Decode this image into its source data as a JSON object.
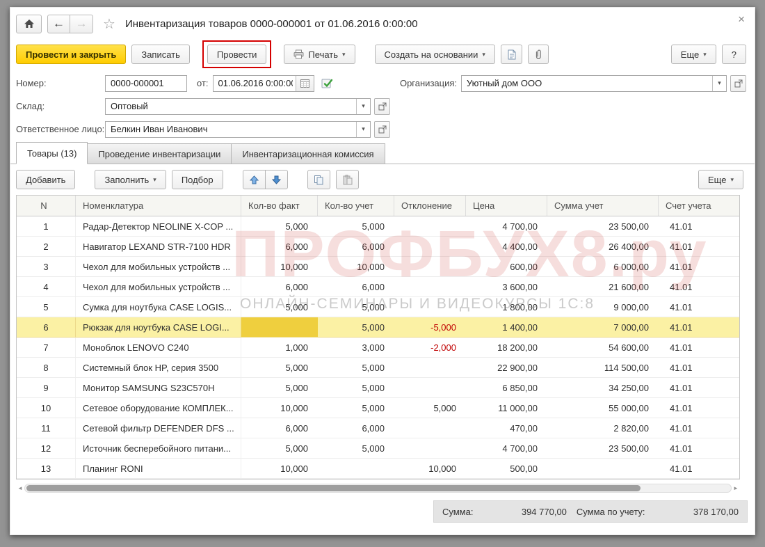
{
  "window": {
    "title": "Инвентаризация товаров 0000-000001 от 01.06.2016 0:00:00"
  },
  "icons": {
    "back": "←",
    "forward": "→",
    "star": "☆",
    "close": "×",
    "caret": "▾",
    "scroll_left": "◄",
    "scroll_right": "►"
  },
  "toolbar": {
    "post_and_close": "Провести и закрыть",
    "write": "Записать",
    "post": "Провести",
    "print": "Печать",
    "create_based_on": "Создать на основании",
    "more": "Еще",
    "help": "?"
  },
  "fields": {
    "number_label": "Номер:",
    "number_value": "0000-000001",
    "date_label": "от:",
    "date_value": "01.06.2016  0:00:00",
    "org_label": "Организация:",
    "org_value": "Уютный дом ООО",
    "warehouse_label": "Склад:",
    "warehouse_value": "Оптовый",
    "responsible_label": "Ответственное лицо:",
    "responsible_value": "Белкин Иван Иванович"
  },
  "tabs": [
    {
      "label": "Товары (13)",
      "active": true
    },
    {
      "label": "Проведение инвентаризации",
      "active": false
    },
    {
      "label": "Инвентаризационная комиссия",
      "active": false
    }
  ],
  "table_toolbar": {
    "add": "Добавить",
    "fill": "Заполнить",
    "pick": "Подбор",
    "more": "Еще"
  },
  "table": {
    "columns": [
      "N",
      "Номенклатура",
      "Кол-во факт",
      "Кол-во учет",
      "Отклонение",
      "Цена",
      "Сумма учет",
      "Счет учета"
    ],
    "rows": [
      {
        "n": "1",
        "name": "Радар-Детектор NEOLINE X-COP ...",
        "fact": "5,000",
        "acc": "5,000",
        "dev": "",
        "price": "4 700,00",
        "sum": "23 500,00",
        "account": "41.01"
      },
      {
        "n": "2",
        "name": "Навигатор LEXAND STR-7100 HDR",
        "fact": "6,000",
        "acc": "6,000",
        "dev": "",
        "price": "4 400,00",
        "sum": "26 400,00",
        "account": "41.01"
      },
      {
        "n": "3",
        "name": "Чехол для мобильных устройств  ...",
        "fact": "10,000",
        "acc": "10,000",
        "dev": "",
        "price": "600,00",
        "sum": "6 000,00",
        "account": "41.01"
      },
      {
        "n": "4",
        "name": "Чехол для мобильных устройств ...",
        "fact": "6,000",
        "acc": "6,000",
        "dev": "",
        "price": "3 600,00",
        "sum": "21 600,00",
        "account": "41.01"
      },
      {
        "n": "5",
        "name": "Сумка для ноутбука CASE LOGIS...",
        "fact": "5,000",
        "acc": "5,000",
        "dev": "",
        "price": "1 800,00",
        "sum": "9 000,00",
        "account": "41.01"
      },
      {
        "n": "6",
        "name": "Рюкзак для ноутбука CASE LOGI...",
        "fact": "",
        "acc": "5,000",
        "dev": "-5,000",
        "price": "1 400,00",
        "sum": "7 000,00",
        "account": "41.01",
        "selected": true,
        "active_cell": "fact"
      },
      {
        "n": "7",
        "name": "Моноблок  LENOVO C240",
        "fact": "1,000",
        "acc": "3,000",
        "dev": "-2,000",
        "price": "18 200,00",
        "sum": "54 600,00",
        "account": "41.01"
      },
      {
        "n": "8",
        "name": "Системный блок HP, серия 3500",
        "fact": "5,000",
        "acc": "5,000",
        "dev": "",
        "price": "22 900,00",
        "sum": "114 500,00",
        "account": "41.01"
      },
      {
        "n": "9",
        "name": "Монитор  SAMSUNG S23C570H",
        "fact": "5,000",
        "acc": "5,000",
        "dev": "",
        "price": "6 850,00",
        "sum": "34 250,00",
        "account": "41.01"
      },
      {
        "n": "10",
        "name": "Сетевое оборудование КОМПЛЕК...",
        "fact": "10,000",
        "acc": "5,000",
        "dev": "5,000",
        "price": "11 000,00",
        "sum": "55 000,00",
        "account": "41.01"
      },
      {
        "n": "11",
        "name": "Сетевой фильтр DEFENDER DFS ...",
        "fact": "6,000",
        "acc": "6,000",
        "dev": "",
        "price": "470,00",
        "sum": "2 820,00",
        "account": "41.01"
      },
      {
        "n": "12",
        "name": "Источник бесперебойного  питани...",
        "fact": "5,000",
        "acc": "5,000",
        "dev": "",
        "price": "4 700,00",
        "sum": "23 500,00",
        "account": "41.01"
      },
      {
        "n": "13",
        "name": "Планинг RONI",
        "fact": "10,000",
        "acc": "",
        "dev": "10,000",
        "price": "500,00",
        "sum": "",
        "account": "41.01"
      }
    ]
  },
  "footer": {
    "sum_label": "Сумма:",
    "sum_value": "394 770,00",
    "sum_acc_label": "Сумма по учету:",
    "sum_acc_value": "378 170,00"
  },
  "watermark": {
    "main": "ПРОФБУХ8.ру",
    "sub": "ОНЛАЙН-СЕМИНАРЫ И ВИДЕОКУРСЫ 1С:8"
  },
  "colors": {
    "primary_button": "#ffcc00",
    "negative": "#c00000",
    "selected_row": "#fbf1a4",
    "active_cell": "#efcf3e",
    "annotation": "#d40000"
  }
}
